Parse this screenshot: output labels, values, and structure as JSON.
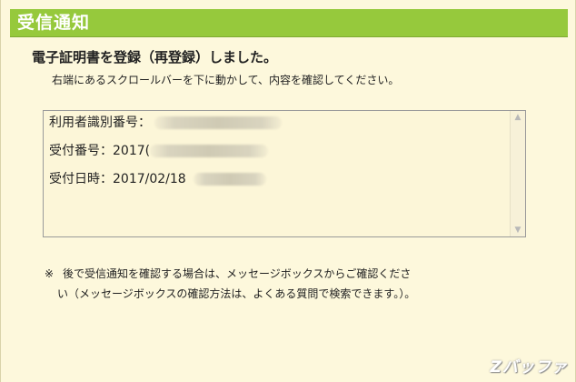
{
  "window": {
    "title": "受信通知"
  },
  "message": {
    "heading": "電子証明書を登録（再登録）しました。",
    "instruction": "右端にあるスクロールバーを下に動かして、内容を確認してください。"
  },
  "details": {
    "user_id_label": "利用者識別番号：",
    "receipt_number_label": "受付番号：",
    "receipt_number_value": "2017(",
    "receipt_datetime_label": "受付日時：",
    "receipt_datetime_value": "2017/02/18"
  },
  "note": {
    "mark": "※",
    "line1": "後で受信通知を確認する場合は、メッセージボックスからご確認くださ",
    "line2": "い（メッセージボックスの確認方法は、よくある質問で検索できます。）。"
  },
  "scrollbar": {
    "up_icon": "▲",
    "down_icon": "▼"
  },
  "watermark": {
    "text": "Zバッファ"
  }
}
